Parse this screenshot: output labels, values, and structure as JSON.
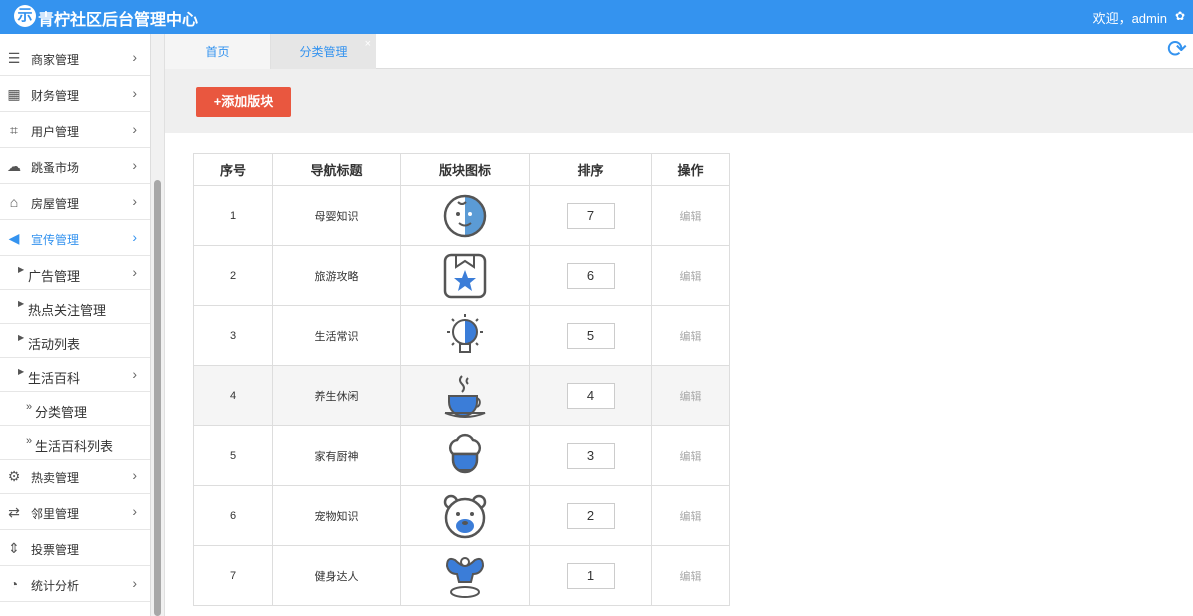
{
  "header": {
    "logo_glyph": "示",
    "title": "青柠社区后台管理中心",
    "welcome": "欢迎，admin",
    "settings_icon": "gear-icon"
  },
  "sidebar": {
    "items": [
      {
        "label": "商家管理",
        "icon": "list-icon"
      },
      {
        "label": "财务管理",
        "icon": "calculator-icon"
      },
      {
        "label": "用户管理",
        "icon": "crop-icon"
      },
      {
        "label": "跳蚤市场",
        "icon": "cloud-icon"
      },
      {
        "label": "房屋管理",
        "icon": "bank-icon"
      },
      {
        "label": "宣传管理",
        "icon": "volume-icon"
      },
      {
        "label": "热卖管理",
        "icon": "gear-icon"
      },
      {
        "label": "邻里管理",
        "icon": "retweet-icon"
      },
      {
        "label": "投票管理",
        "icon": "sort-icon"
      },
      {
        "label": "统计分析",
        "icon": "pie-chart-icon"
      }
    ],
    "sub_items": [
      "广告管理",
      "热点关注管理",
      "活动列表",
      "生活百科"
    ],
    "sub2_items": [
      "分类管理",
      "生活百科列表"
    ],
    "accent_color": "#3493ef"
  },
  "tabs": {
    "home": "首页",
    "current": "分类管理",
    "close": "×"
  },
  "toolbar": {
    "add_label": "+添加版块"
  },
  "table": {
    "headers": [
      "序号",
      "导航标题",
      "版块图标",
      "排序",
      "操作"
    ],
    "rows": [
      {
        "no": "1",
        "title": "母婴知识",
        "icon": "baby-icon",
        "order": "7",
        "action": "编辑"
      },
      {
        "no": "2",
        "title": "旅游攻略",
        "icon": "bookmark-star-icon",
        "order": "6",
        "action": "编辑"
      },
      {
        "no": "3",
        "title": "生活常识",
        "icon": "lightbulb-icon",
        "order": "5",
        "action": "编辑"
      },
      {
        "no": "4",
        "title": "养生休闲",
        "icon": "coffee-cup-icon",
        "order": "4",
        "action": "编辑"
      },
      {
        "no": "5",
        "title": "家有厨神",
        "icon": "chef-hat-icon",
        "order": "3",
        "action": "编辑"
      },
      {
        "no": "6",
        "title": "宠物知识",
        "icon": "bear-icon",
        "order": "2",
        "action": "编辑"
      },
      {
        "no": "7",
        "title": "健身达人",
        "icon": "bodybuilder-icon",
        "order": "1",
        "action": "编辑"
      }
    ]
  }
}
